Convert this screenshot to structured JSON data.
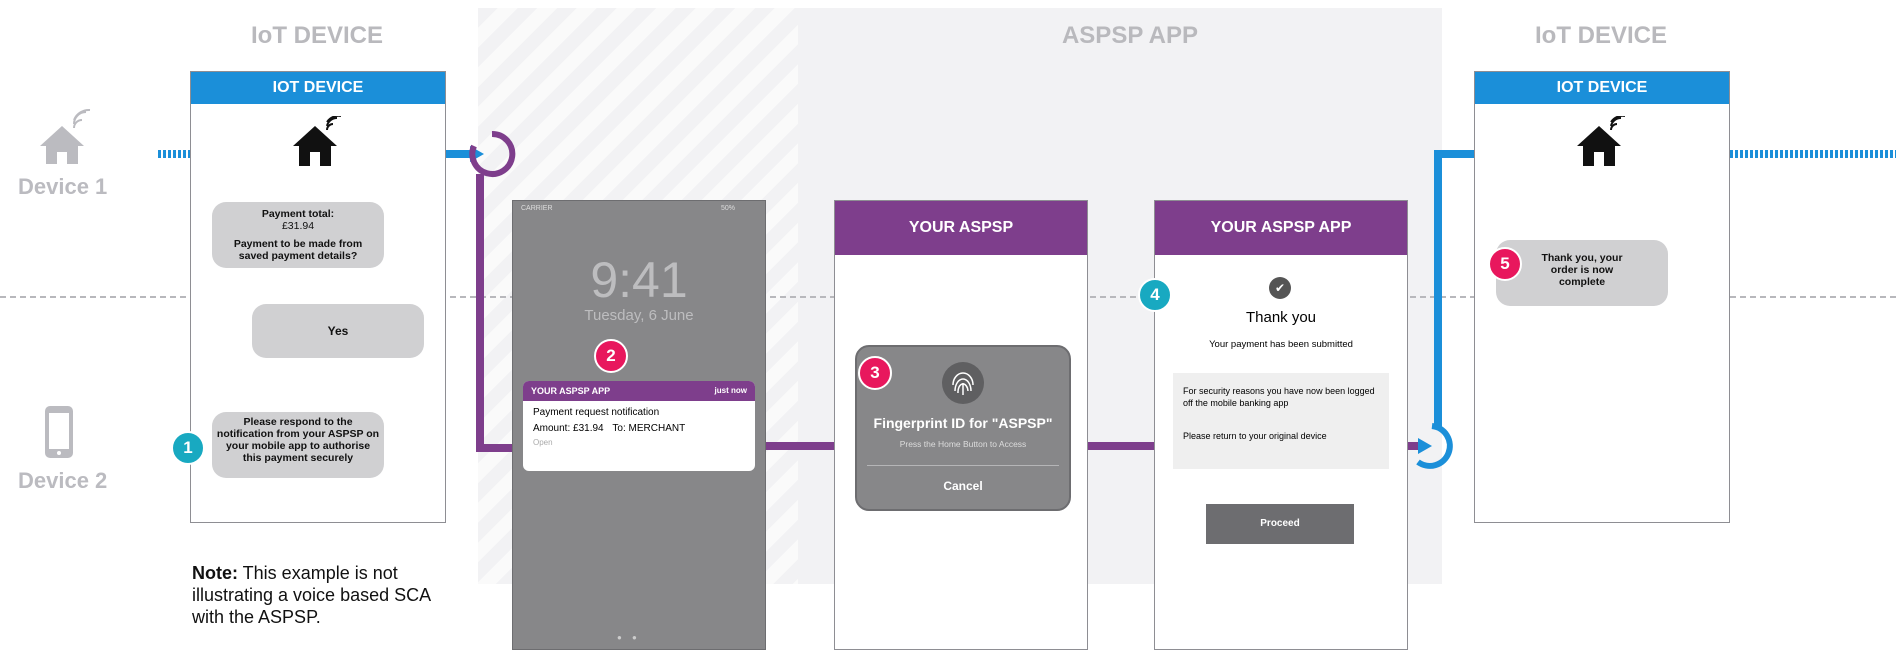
{
  "sections": {
    "left": "IoT DEVICE",
    "middle": "ASPSP APP",
    "right": "IoT DEVICE"
  },
  "devices": {
    "device1": "Device 1",
    "device2": "Device 2"
  },
  "iot_left": {
    "header": "IOT DEVICE",
    "bubble_payment_total_label": "Payment total:",
    "bubble_payment_total_value": "£31.94",
    "bubble_saved_details": "Payment to be made from saved payment details?",
    "bubble_yes": "Yes",
    "bubble_respond": "Please respond to the notification from your ASPSP on your mobile app to authorise this payment securely"
  },
  "phone": {
    "carrier": "CARRIER",
    "battery": "50%",
    "time": "9:41",
    "date": "Tuesday, 6 June",
    "notif_app": "YOUR ASPSP APP",
    "notif_when": "just now",
    "notif_title": "Payment request notification",
    "notif_amount_label": "Amount:",
    "notif_amount": "£31.94",
    "notif_to_label": "To:",
    "notif_to": "MERCHANT",
    "notif_open": "Open"
  },
  "aspsp_app": {
    "header": "YOUR ASPSP",
    "fingerprint_title": "Fingerprint ID for \"ASPSP\"",
    "fingerprint_sub": "Press the Home Button to Access",
    "cancel": "Cancel"
  },
  "aspsp_app2": {
    "header": "YOUR ASPSP APP",
    "thank_you": "Thank you",
    "submitted": "Your payment has been submitted",
    "security_note": "For security reasons you have now been logged off the mobile banking app",
    "return_note": "Please return to your original device",
    "proceed": "Proceed"
  },
  "iot_right": {
    "header": "IOT DEVICE",
    "bubble_complete": "Thank you, your order is now complete"
  },
  "steps": [
    "1",
    "2",
    "3",
    "4",
    "5"
  ],
  "note": {
    "bold": "Note:",
    "text": " This example is not illustrating a voice based SCA with the ASPSP."
  },
  "colors": {
    "blue": "#1b8fd9",
    "purple": "#7e3e8c",
    "pink": "#e8175d",
    "teal": "#18a9c1"
  },
  "icons": {
    "home": "home-wifi-icon",
    "phone": "smartphone-icon",
    "fingerprint": "fingerprint-icon",
    "check": "checkmark-icon"
  }
}
